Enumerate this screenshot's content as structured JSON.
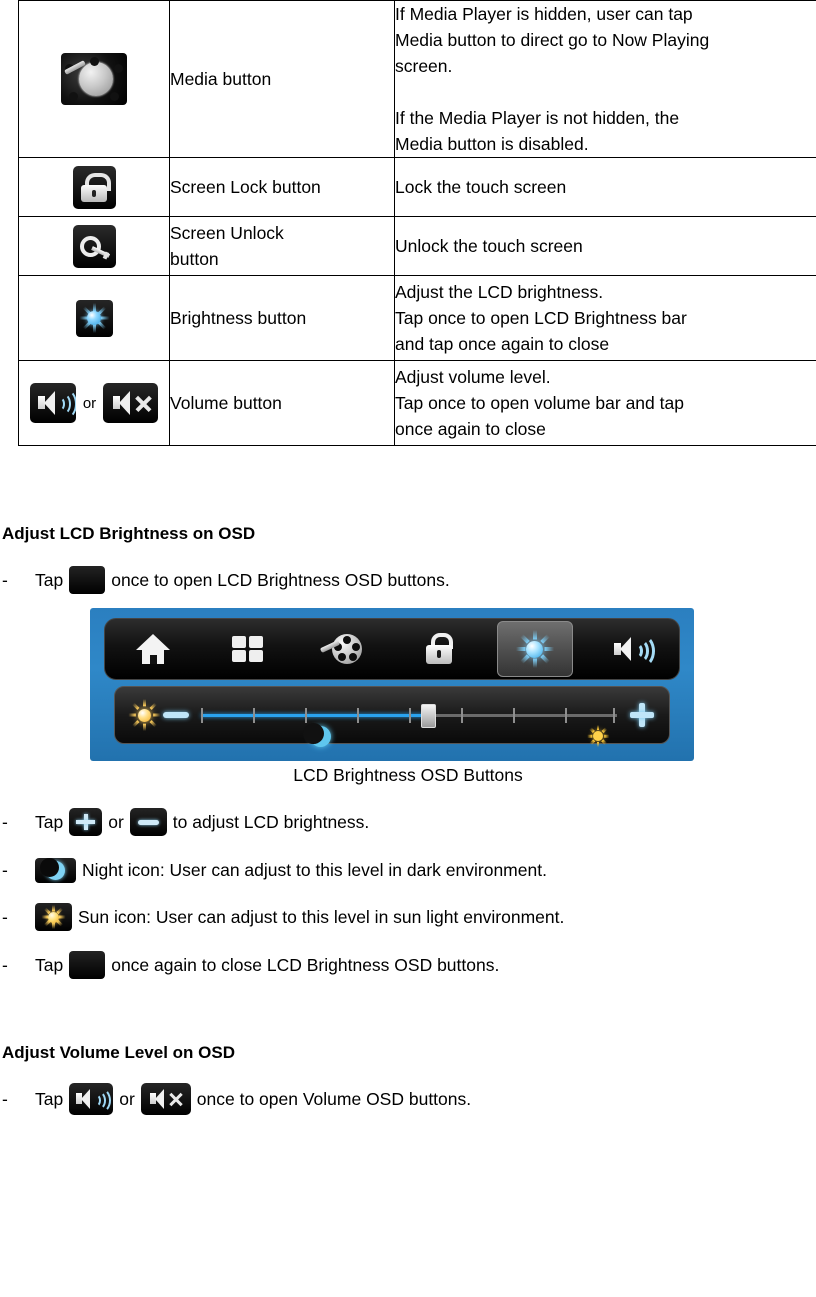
{
  "table": {
    "rows": [
      {
        "icon": "media-button-icon",
        "name": "Media button",
        "desc_lines": [
          "If Media Player is hidden, user can tap",
          "Media button to direct go to Now Playing",
          "screen.",
          "",
          "If the Media Player is not hidden, the",
          "Media button is disabled."
        ]
      },
      {
        "icon": "screen-lock-icon",
        "name": "Screen Lock button",
        "desc_lines": [
          "Lock the touch screen"
        ]
      },
      {
        "icon": "screen-unlock-icon",
        "name_lines": [
          "Screen Unlock",
          "button"
        ],
        "desc_lines": [
          "Unlock the touch screen"
        ]
      },
      {
        "icon": "brightness-icon",
        "name": "Brightness button",
        "desc_lines": [
          "Adjust the LCD brightness.",
          "Tap once to open LCD Brightness bar",
          "and tap once again to close"
        ]
      },
      {
        "icon": "volume-icon",
        "icon_separator": "or",
        "icon2": "volume-mute-icon",
        "name": "Volume button",
        "desc_lines": [
          "Adjust volume level.",
          "Tap once to open volume bar and tap",
          "once again to close"
        ]
      }
    ]
  },
  "sections": [
    {
      "heading": "Adjust LCD Brightness on OSD",
      "bullets": [
        {
          "dash": "-",
          "pre": "Tap",
          "icon": "brightness-icon",
          "post": "once to open LCD Brightness OSD buttons."
        }
      ],
      "figure_caption": "LCD Brightness OSD Buttons",
      "bullets_after": [
        {
          "dash": "-",
          "pre": "Tap",
          "icon": "plus-icon",
          "mid": "or",
          "icon2": "minus-icon",
          "post": "to adjust LCD brightness."
        },
        {
          "dash": "-",
          "pre": "",
          "icon": "moon-icon",
          "post": "Night icon: User can adjust to this level in dark environment."
        },
        {
          "dash": "-",
          "pre": "",
          "icon": "sun-icon",
          "post": "Sun icon: User can adjust to this level in sun light environment."
        },
        {
          "dash": "-",
          "pre": "Tap",
          "icon": "brightness-icon",
          "post": "once again to close LCD Brightness OSD buttons."
        }
      ]
    },
    {
      "heading": "Adjust Volume Level on OSD",
      "bullets": [
        {
          "dash": "-",
          "pre": "Tap",
          "icon": "volume-icon",
          "mid": "or",
          "icon2": "volume-mute-icon",
          "post": "once to open Volume OSD buttons."
        }
      ]
    }
  ],
  "osd": {
    "buttons": [
      "home-icon",
      "apps-grid-icon",
      "media-icon",
      "lock-icon",
      "brightness-icon",
      "volume-icon"
    ],
    "selected_index": 4,
    "slider": {
      "minus_icon": "minus-icon",
      "plus_icon": "plus-icon",
      "left_icon": "sun-outline-icon",
      "moon_icon": "moon-icon",
      "sun_icon": "sun-icon",
      "value_percent": 54,
      "tick_count": 9
    },
    "colors": {
      "frame": "#2b7fc0",
      "accent": "#2aa3ef",
      "panel": "#0d0d0d"
    }
  }
}
